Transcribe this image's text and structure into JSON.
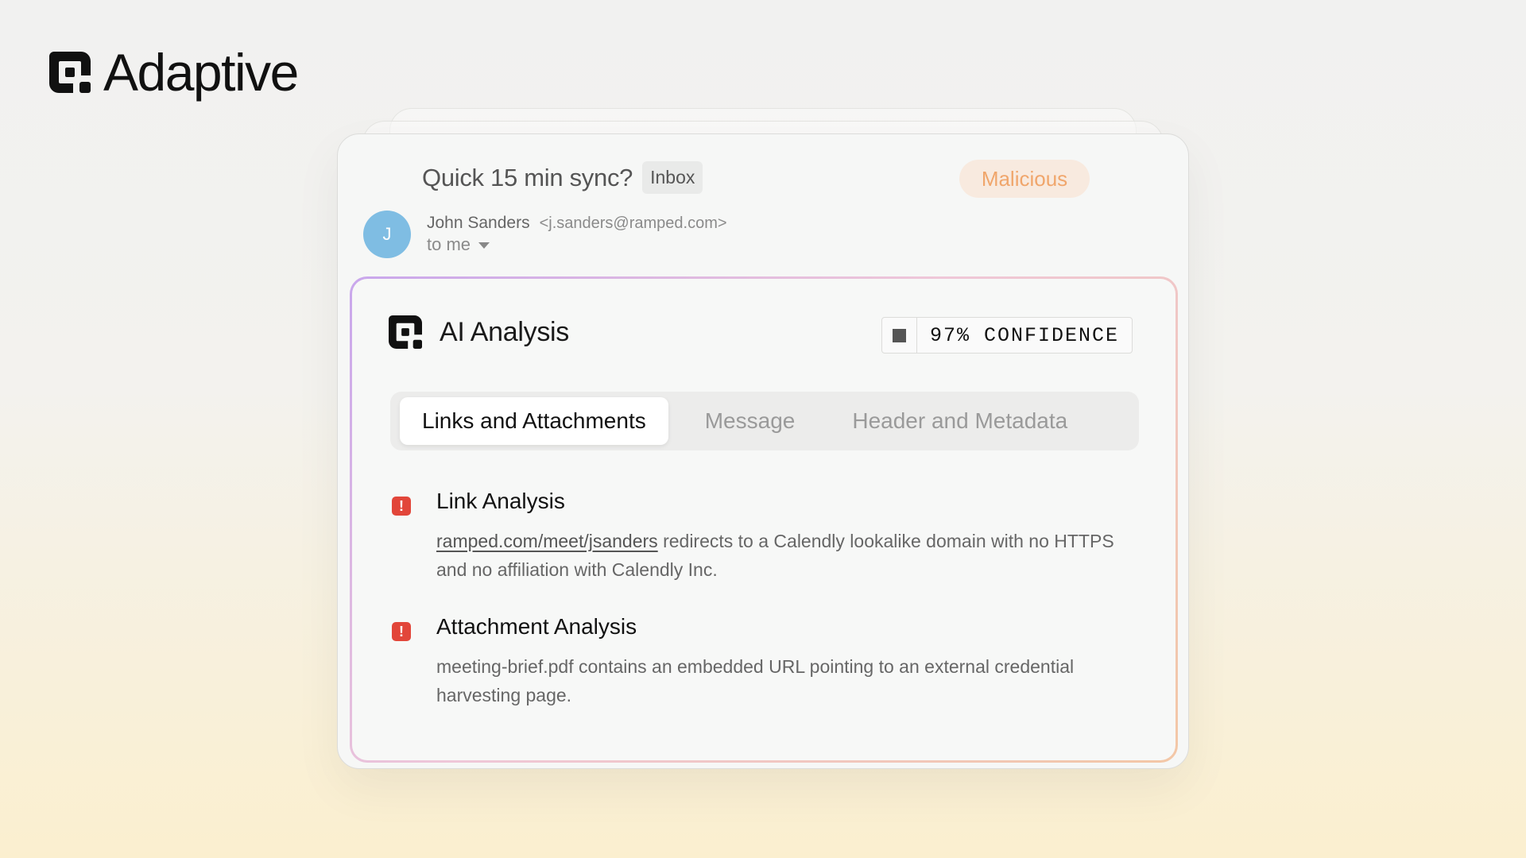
{
  "brand": {
    "name": "Adaptive",
    "logo_icon": "adaptive-logo-icon"
  },
  "email": {
    "subject": "Quick 15 min sync?",
    "folder_badge": "Inbox",
    "verdict": "Malicious",
    "verdict_color": "#f0a66c",
    "avatar_initial": "J",
    "avatar_color": "#7fbde3",
    "sender_name": "John Sanders",
    "sender_email": "<j.sanders@ramped.com>",
    "recipient": "to me"
  },
  "analysis": {
    "title": "AI Analysis",
    "confidence": "97% CONFIDENCE",
    "tabs": [
      {
        "label": "Links and Attachments",
        "active": true
      },
      {
        "label": "Message",
        "active": false
      },
      {
        "label": "Header and Metadata",
        "active": false
      }
    ],
    "items": [
      {
        "title": "Link Analysis",
        "link": "ramped.com/meet/jsanders",
        "body": " redirects to a Calendly lookalike domain with no HTTPS and no affiliation with Calendly Inc.",
        "icon": "alert-icon"
      },
      {
        "title": "Attachment Analysis",
        "body": "meeting-brief.pdf contains an embedded URL pointing to an external credential harvesting page.",
        "icon": "alert-icon"
      }
    ],
    "alert_color": "#e2463a"
  }
}
